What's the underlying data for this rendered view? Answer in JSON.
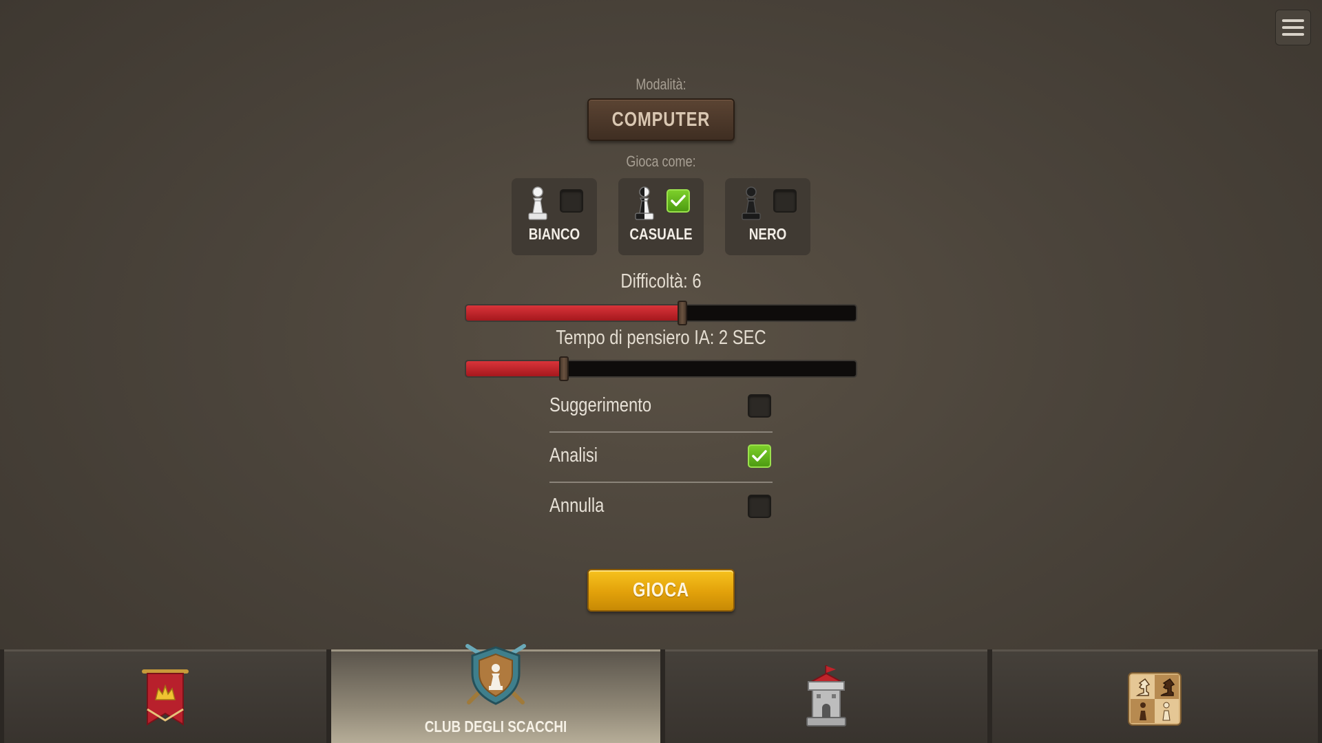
{
  "menu": {
    "icon": "hamburger-menu-icon"
  },
  "mode": {
    "label": "Modalità:",
    "value": "COMPUTER"
  },
  "play_as": {
    "label": "Gioca come:",
    "options": [
      {
        "name": "BIANCO",
        "icon": "white-pawn-icon",
        "checked": false
      },
      {
        "name": "CASUALE",
        "icon": "half-pawn-icon",
        "checked": true
      },
      {
        "name": "NERO",
        "icon": "black-pawn-icon",
        "checked": false
      }
    ]
  },
  "difficulty": {
    "label": "Difficoltà: 6",
    "value": 6,
    "fraction": 0.555
  },
  "think_time": {
    "label": "Tempo di pensiero IA: 2 SEC",
    "value": 2,
    "fraction": 0.25
  },
  "options": [
    {
      "label": "Suggerimento",
      "checked": false
    },
    {
      "label": "Analisi",
      "checked": true
    },
    {
      "label": "Annulla",
      "checked": false
    }
  ],
  "play_button": {
    "label": "GIOCA"
  },
  "tabs": [
    {
      "icon": "crown-banner-icon",
      "label": "",
      "active": false
    },
    {
      "icon": "shield-pawn-icon",
      "label": "CLUB DEGLI SCACCHI",
      "active": true
    },
    {
      "icon": "castle-tower-icon",
      "label": "",
      "active": false
    },
    {
      "icon": "chess-pieces-board-icon",
      "label": "",
      "active": false
    }
  ],
  "colors": {
    "accent_red": "#c0242a",
    "check_green": "#5cb31b",
    "play_yellow": "#eab014",
    "mode_brown": "#4e3a2b"
  }
}
